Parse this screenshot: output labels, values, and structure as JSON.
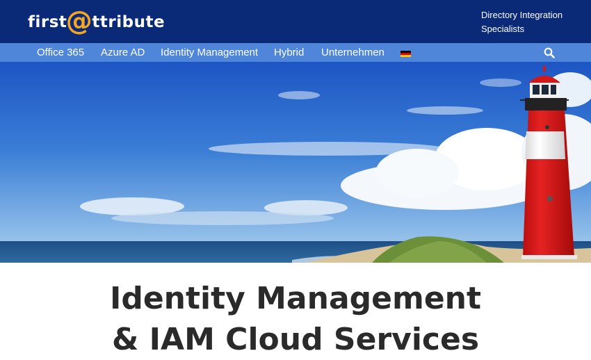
{
  "header": {
    "logo": {
      "text_before": "first",
      "at_symbol": "@",
      "text_after": "ttribute"
    },
    "tagline_line1": "Directory Integration",
    "tagline_line2": "Specialists"
  },
  "nav": {
    "items": [
      {
        "label": "Office 365"
      },
      {
        "label": "Azure AD"
      },
      {
        "label": "Identity Management"
      },
      {
        "label": "Hybrid"
      },
      {
        "label": "Unternehmen"
      }
    ],
    "language_flag": "german-flag-icon",
    "search_icon": "search-icon"
  },
  "hero": {
    "image": "lighthouse-beach-photo"
  },
  "main": {
    "heading_line1": "Identity Management",
    "heading_line2": "& IAM Cloud Services"
  },
  "colors": {
    "header_bg": "#0a2a78",
    "nav_bg": "#4f86d9",
    "logo_accent": "#f5a623",
    "heading_text": "#2a2a2a"
  }
}
